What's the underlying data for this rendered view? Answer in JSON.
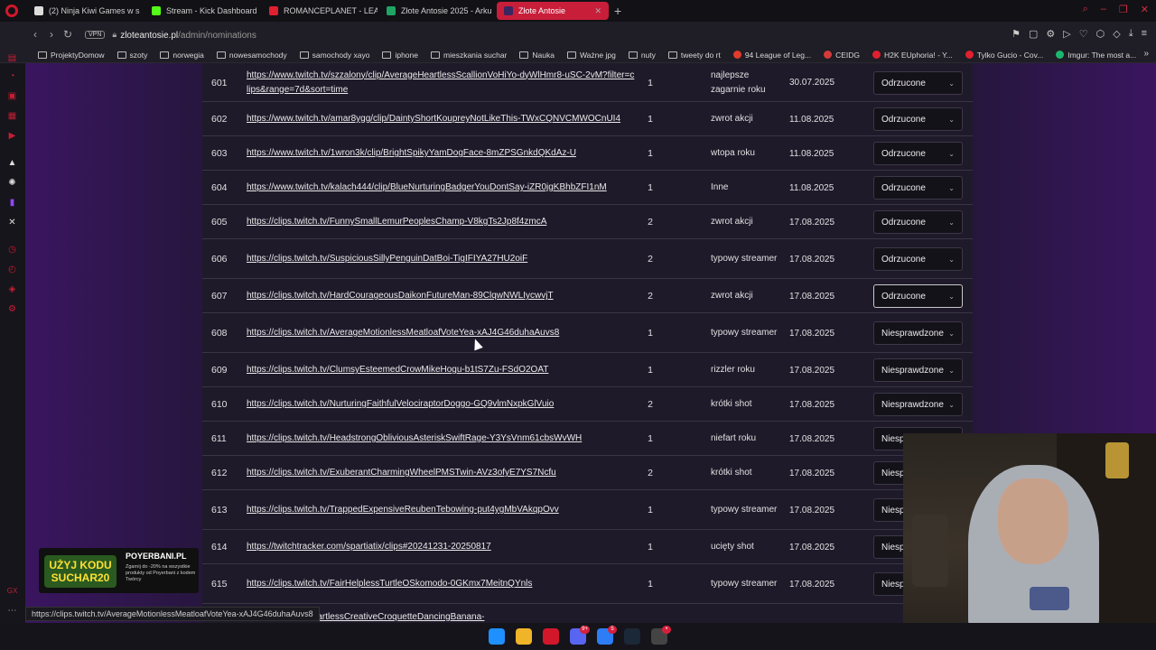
{
  "tabs": [
    {
      "title": "(2) Ninja Kiwi Games w s",
      "color": "#dddddd",
      "active": false
    },
    {
      "title": "Stream - Kick Dashboard",
      "color": "#53fc18",
      "active": false
    },
    {
      "title": "ROMANCEPLANET - LEA",
      "color": "#e0202f",
      "active": false
    },
    {
      "title": "Złote Antosie 2025 - Arku",
      "color": "#1fa463",
      "active": false
    },
    {
      "title": "Złote Antosie",
      "color": "#3a2660",
      "active": true
    }
  ],
  "address": {
    "vpn": "VPN",
    "host": "zloteantosie.pl",
    "path": "/admin/nominations"
  },
  "bookmarks": [
    {
      "label": "ProjektyDomow",
      "type": "folder"
    },
    {
      "label": "szoty",
      "type": "folder"
    },
    {
      "label": "norwegia",
      "type": "folder"
    },
    {
      "label": "nowesamochody",
      "type": "folder"
    },
    {
      "label": "samochody xayo",
      "type": "folder"
    },
    {
      "label": "iphone",
      "type": "folder"
    },
    {
      "label": "mieszkania suchar",
      "type": "folder"
    },
    {
      "label": "Nauka",
      "type": "folder"
    },
    {
      "label": "Ważne jpg",
      "type": "folder"
    },
    {
      "label": "nuty",
      "type": "folder"
    },
    {
      "label": "tweety do rt",
      "type": "folder"
    },
    {
      "label": "94 League of Leg...",
      "type": "site",
      "color": "#e23a2c"
    },
    {
      "label": "CEIDG",
      "type": "site",
      "color": "#d23b3b"
    },
    {
      "label": "H2K EUphoria! - Y...",
      "type": "site",
      "color": "#e0202f"
    },
    {
      "label": "Tylko Gucio - Cov...",
      "type": "site",
      "color": "#e0202f"
    },
    {
      "label": "Imgur: The most a...",
      "type": "site",
      "color": "#1bb76e"
    }
  ],
  "rows": [
    {
      "id": "601",
      "link": "https://www.twitch.tv/szzalony/clip/AverageHeartlessScallionVoHiYo-dyWlHmr8-uSC-2vM?filter=clips&range=7d&sort=time",
      "votes": "1",
      "category": "najlepsze zagarnie roku",
      "date": "30.07.2025",
      "status": "Odrzucone"
    },
    {
      "id": "602",
      "link": "https://www.twitch.tv/amar8ygg/clip/DaintyShortKoupreyNotLikeThis-TWxCQNVCMWOCnUI4",
      "votes": "1",
      "category": "zwrot akcji",
      "date": "11.08.2025",
      "status": "Odrzucone"
    },
    {
      "id": "603",
      "link": "https://www.twitch.tv/1wron3k/clip/BrightSpikyYamDogFace-8mZPSGnkdQKdAz-U",
      "votes": "1",
      "category": "wtopa roku",
      "date": "11.08.2025",
      "status": "Odrzucone"
    },
    {
      "id": "604",
      "link": "https://www.twitch.tv/kalach444/clip/BlueNurturingBadgerYouDontSay-iZR0jgKBhbZFI1nM",
      "votes": "1",
      "category": "Inne",
      "date": "11.08.2025",
      "status": "Odrzucone"
    },
    {
      "id": "605",
      "link": "https://clips.twitch.tv/FunnySmallLemurPeoplesChamp-V8kgTs2Jp8f4zmcA",
      "votes": "2",
      "category": "zwrot akcji",
      "date": "17.08.2025",
      "status": "Odrzucone"
    },
    {
      "id": "606",
      "link": "https://clips.twitch.tv/SuspiciousSillyPenguinDatBoi-TigIFIYA27HU2oiF",
      "votes": "2",
      "category": "typowy streamer",
      "date": "17.08.2025",
      "status": "Odrzucone"
    },
    {
      "id": "607",
      "link": "https://clips.twitch.tv/HardCourageousDaikonFutureMan-89ClqwNWLIycwvjT",
      "votes": "2",
      "category": "zwrot akcji",
      "date": "17.08.2025",
      "status": "Odrzucone"
    },
    {
      "id": "608",
      "link": "https://clips.twitch.tv/AverageMotionlessMeatloafVoteYea-xAJ4G46duhaAuvs8",
      "votes": "1",
      "category": "typowy streamer",
      "date": "17.08.2025",
      "status": "Niesprawdzone"
    },
    {
      "id": "609",
      "link": "https://clips.twitch.tv/ClumsyEsteemedCrowMikeHogu-b1tS7Zu-FSdO2OAT",
      "votes": "1",
      "category": "rizzler roku",
      "date": "17.08.2025",
      "status": "Niesprawdzone"
    },
    {
      "id": "610",
      "link": "https://clips.twitch.tv/NurturingFaithfulVelociraptorDoggo-GQ9vlmNxpkGlVuio",
      "votes": "2",
      "category": "krótki shot",
      "date": "17.08.2025",
      "status": "Niesprawdzone"
    },
    {
      "id": "611",
      "link": "https://clips.twitch.tv/HeadstrongObliviousAsteriskSwiftRage-Y3YsVnm61cbsWvWH",
      "votes": "1",
      "category": "niefart roku",
      "date": "17.08.2025",
      "status": "Niesp"
    },
    {
      "id": "612",
      "link": "https://clips.twitch.tv/ExuberantCharmingWheelPMSTwin-AVz3ofyE7YS7Ncfu",
      "votes": "2",
      "category": "krótki shot",
      "date": "17.08.2025",
      "status": "Niesp"
    },
    {
      "id": "613",
      "link": "https://clips.twitch.tv/TrappedExpensiveReubenTebowing-put4ygMbVAkqpOvv",
      "votes": "1",
      "category": "typowy streamer",
      "date": "17.08.2025",
      "status": "Niesp"
    },
    {
      "id": "614",
      "link": "https://twitchtracker.com/spartiatix/clips#20241231-20250817",
      "votes": "1",
      "category": "ucięty shot",
      "date": "17.08.2025",
      "status": "Niesp"
    },
    {
      "id": "615",
      "link": "https://clips.twitch.tv/FairHelplessTurtleOSkomodo-0GKmx7MeitnQYnls",
      "votes": "1",
      "category": "typowy streamer",
      "date": "17.08.2025",
      "status": "Niesp"
    },
    {
      "id": "",
      "link": "...laskol95/clip/HeartlessCreativeCroquetteDancingBanana-",
      "votes": "",
      "category": "",
      "date": "",
      "status": ""
    }
  ],
  "promo": {
    "code": "UŻYJ KODU SUCHAR20",
    "brand": "POYERBANI.PL",
    "note": "Zgarnij do -20% na wszystkie produkty od Poyerbani z kodem Twórcy"
  },
  "statusbar": "https://clips.twitch.tv/AverageMotionlessMeatloafVoteYea-xAJ4G46duhaAuvs8",
  "taskbar": [
    {
      "name": "windows-start-icon",
      "color": "#1e90ff"
    },
    {
      "name": "file-explorer-icon",
      "color": "#f0b429"
    },
    {
      "name": "opera-icon",
      "color": "#d2172b"
    },
    {
      "name": "discord-icon",
      "color": "#5865f2",
      "badge": "9+"
    },
    {
      "name": "messenger-icon",
      "color": "#2c7df6",
      "badge": "5"
    },
    {
      "name": "steam-icon",
      "color": "#1b2838"
    },
    {
      "name": "opera-gx-icon",
      "color": "#444",
      "badge": "•"
    }
  ]
}
